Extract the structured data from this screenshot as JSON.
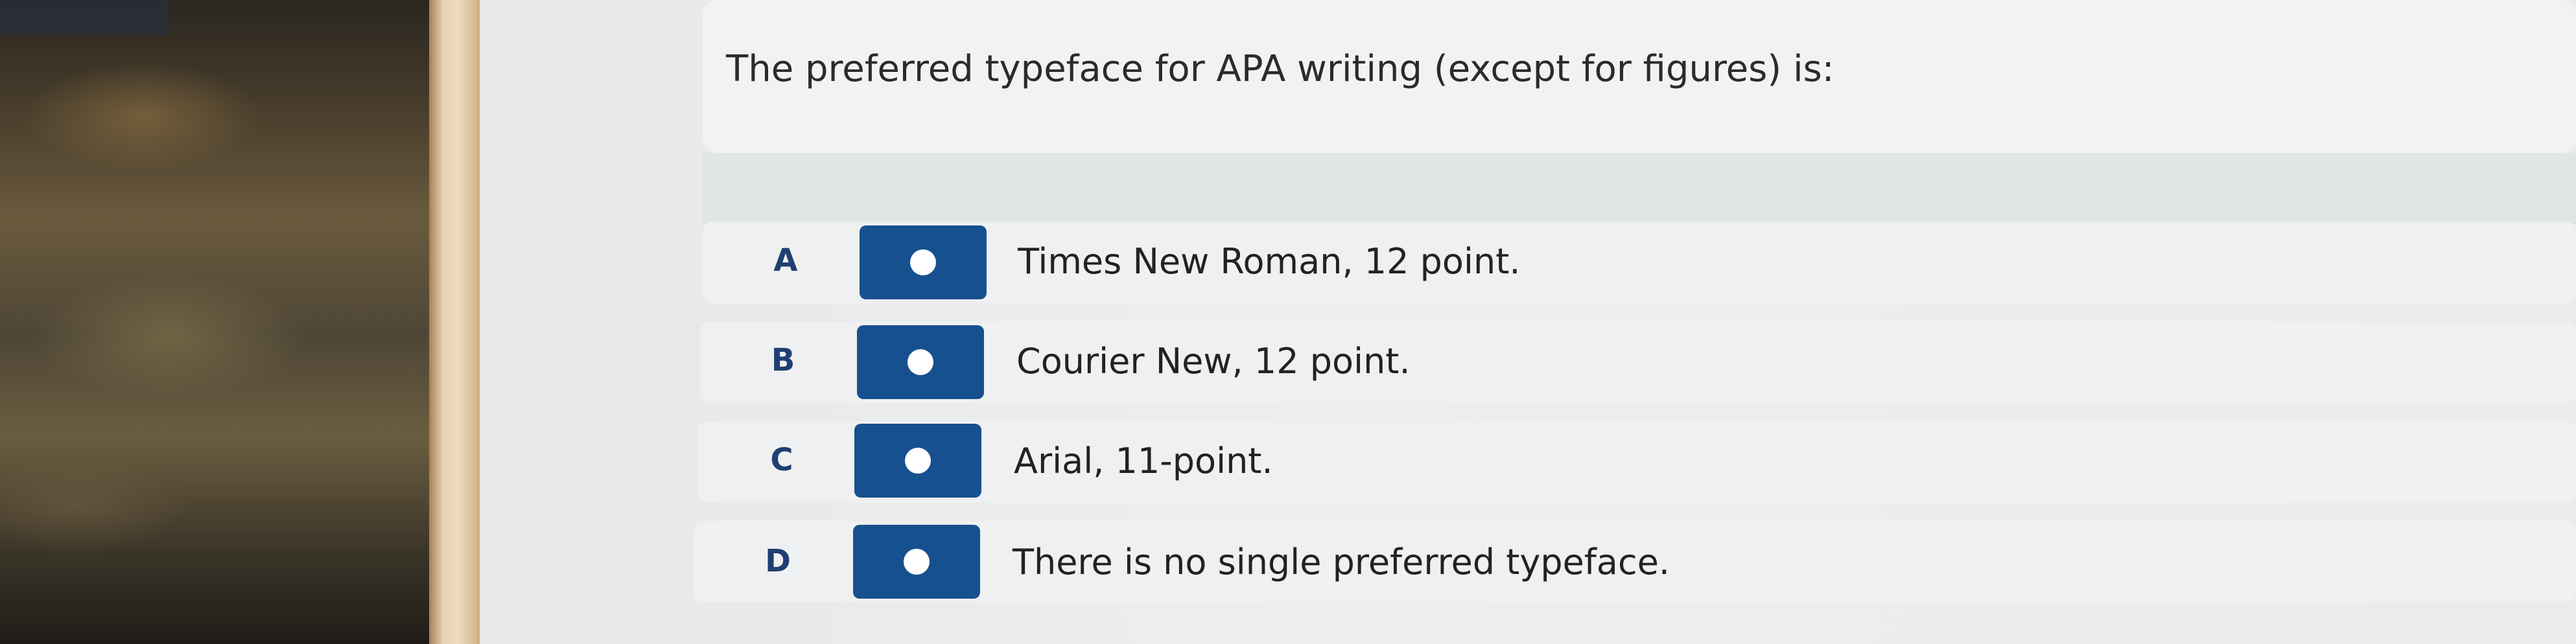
{
  "question": {
    "text": "The preferred typeface for APA writing (except for figures) is:"
  },
  "options": [
    {
      "letter": "A",
      "text": "Times New Roman, 12 point.",
      "selected": false
    },
    {
      "letter": "B",
      "text": "Courier New, 12 point.",
      "selected": false
    },
    {
      "letter": "C",
      "text": "Arial, 11-point.",
      "selected": false
    },
    {
      "letter": "D",
      "text": "There is no single preferred typeface.",
      "selected": false
    }
  ],
  "colors": {
    "radio_button": "#17508f",
    "letter": "#1f3f72",
    "text": "#222222"
  }
}
